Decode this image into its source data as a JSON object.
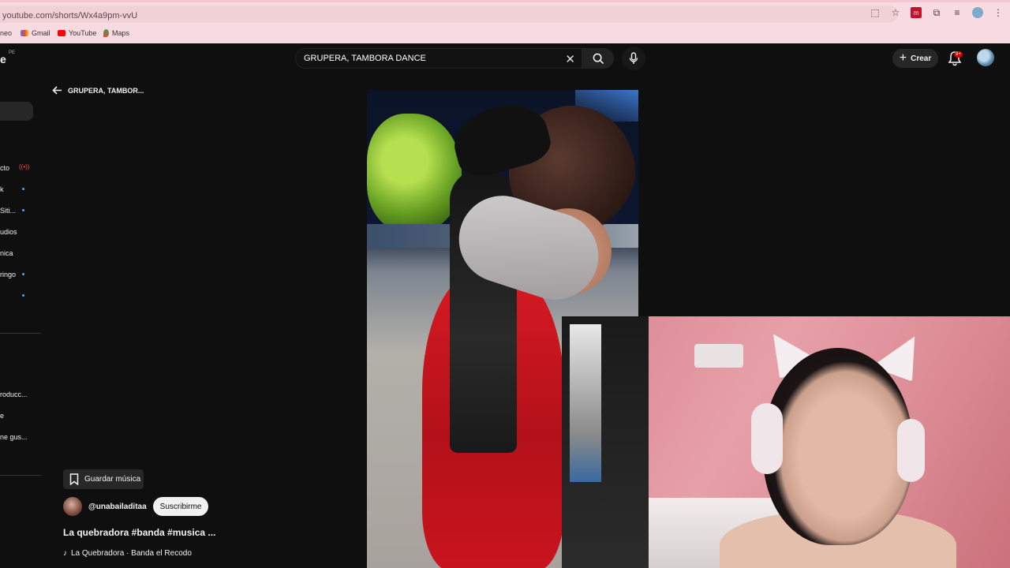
{
  "browser": {
    "url": "youtube.com/shorts/Wx4a9pm-vvU",
    "bookmarks": [
      {
        "label": "neo",
        "icon": "bookmark-icon"
      },
      {
        "label": "Gmail",
        "icon": "gmail-icon"
      },
      {
        "label": "YouTube",
        "icon": "youtube-icon"
      },
      {
        "label": "Maps",
        "icon": "maps-icon"
      }
    ]
  },
  "header": {
    "logo_fragment": "e",
    "region": "PE",
    "search_query": "GRUPERA, TAMBORA DANCE",
    "create_label": "Crear",
    "notifications_badge": "9+"
  },
  "sidebar": {
    "items": [
      {
        "label": "cto"
      },
      {
        "label": "k"
      },
      {
        "label": "Siti..."
      },
      {
        "label": "udios"
      },
      {
        "label": "nica"
      },
      {
        "label": "ringo"
      },
      {
        "label": "roducc..."
      },
      {
        "label": "e"
      },
      {
        "label": "ne gus..."
      }
    ]
  },
  "shorts": {
    "back_label": "GRUPERA, TAMBOR...",
    "save_music_label": "Guardar música",
    "channel_handle": "@unabailaditaa",
    "subscribe_label": "Suscribirme",
    "title": "La quebradora #banda #musica ...",
    "music": "La Quebradora · Banda el Recodo"
  },
  "colors": {
    "background": "#0f0f0f",
    "browser_bar": "#f8dbe0",
    "live_indicator": "#ff4e45",
    "new_dot": "#3ea6ff"
  }
}
